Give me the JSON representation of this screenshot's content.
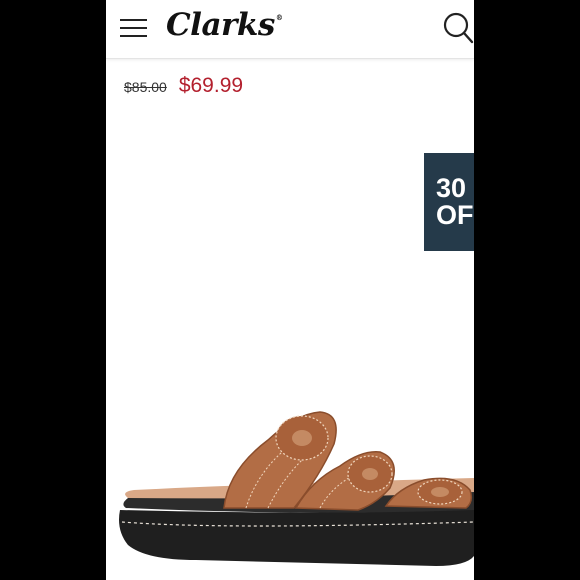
{
  "header": {
    "menu_icon": "hamburger-menu-icon",
    "brand": "Clarks",
    "brand_mark": "®",
    "search_icon": "search-icon"
  },
  "product": {
    "original_price": "$85.00",
    "sale_price": "$69.99",
    "image_alt": "Brown leather slide sandal"
  },
  "promo_badge": {
    "line1": "30",
    "line2": "OF"
  },
  "colors": {
    "sale_price": "#b3202e",
    "badge_background": "#253a4a",
    "sandal_leather": "#b26d45",
    "sole": "#1f1f1f"
  }
}
